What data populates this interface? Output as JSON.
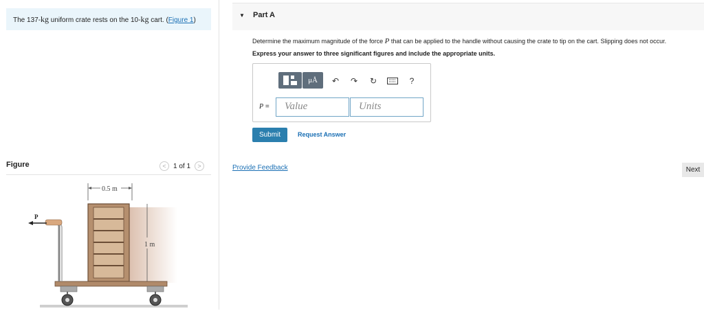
{
  "problem": {
    "text_before": "The 137-",
    "unit1": "kg",
    "text_middle": " uniform crate rests on the 10-",
    "unit2": "kg",
    "text_after": " cart. (",
    "figure_link": "Figure 1",
    "close_paren": ")"
  },
  "figure_panel": {
    "label": "Figure",
    "pager": "1 of 1",
    "prev_icon": "chevron-left-icon",
    "next_icon": "chevron-right-icon",
    "dim_width": "0.5 m",
    "dim_height": "1 m",
    "force_label": "P"
  },
  "part": {
    "title": "Part A",
    "question_before": "Determine the maximum magnitude of the force ",
    "question_var": "P",
    "question_after": " that can be applied to the handle without causing the crate to tip on the cart. Slipping does not occur.",
    "instruction": "Express your answer to three significant figures and include the appropriate units."
  },
  "toolbar": {
    "mu_label": "μÅ",
    "help_label": "?",
    "icons": [
      "templates-icon",
      "units-mu-icon",
      "undo-icon",
      "redo-icon",
      "reset-icon",
      "keyboard-icon",
      "help-icon"
    ]
  },
  "answer": {
    "var_label": "P",
    "eq": " =",
    "value_placeholder": "Value",
    "units_placeholder": "Units"
  },
  "actions": {
    "submit": "Submit",
    "request_answer": "Request Answer",
    "feedback": "Provide Feedback",
    "next": "Next"
  }
}
